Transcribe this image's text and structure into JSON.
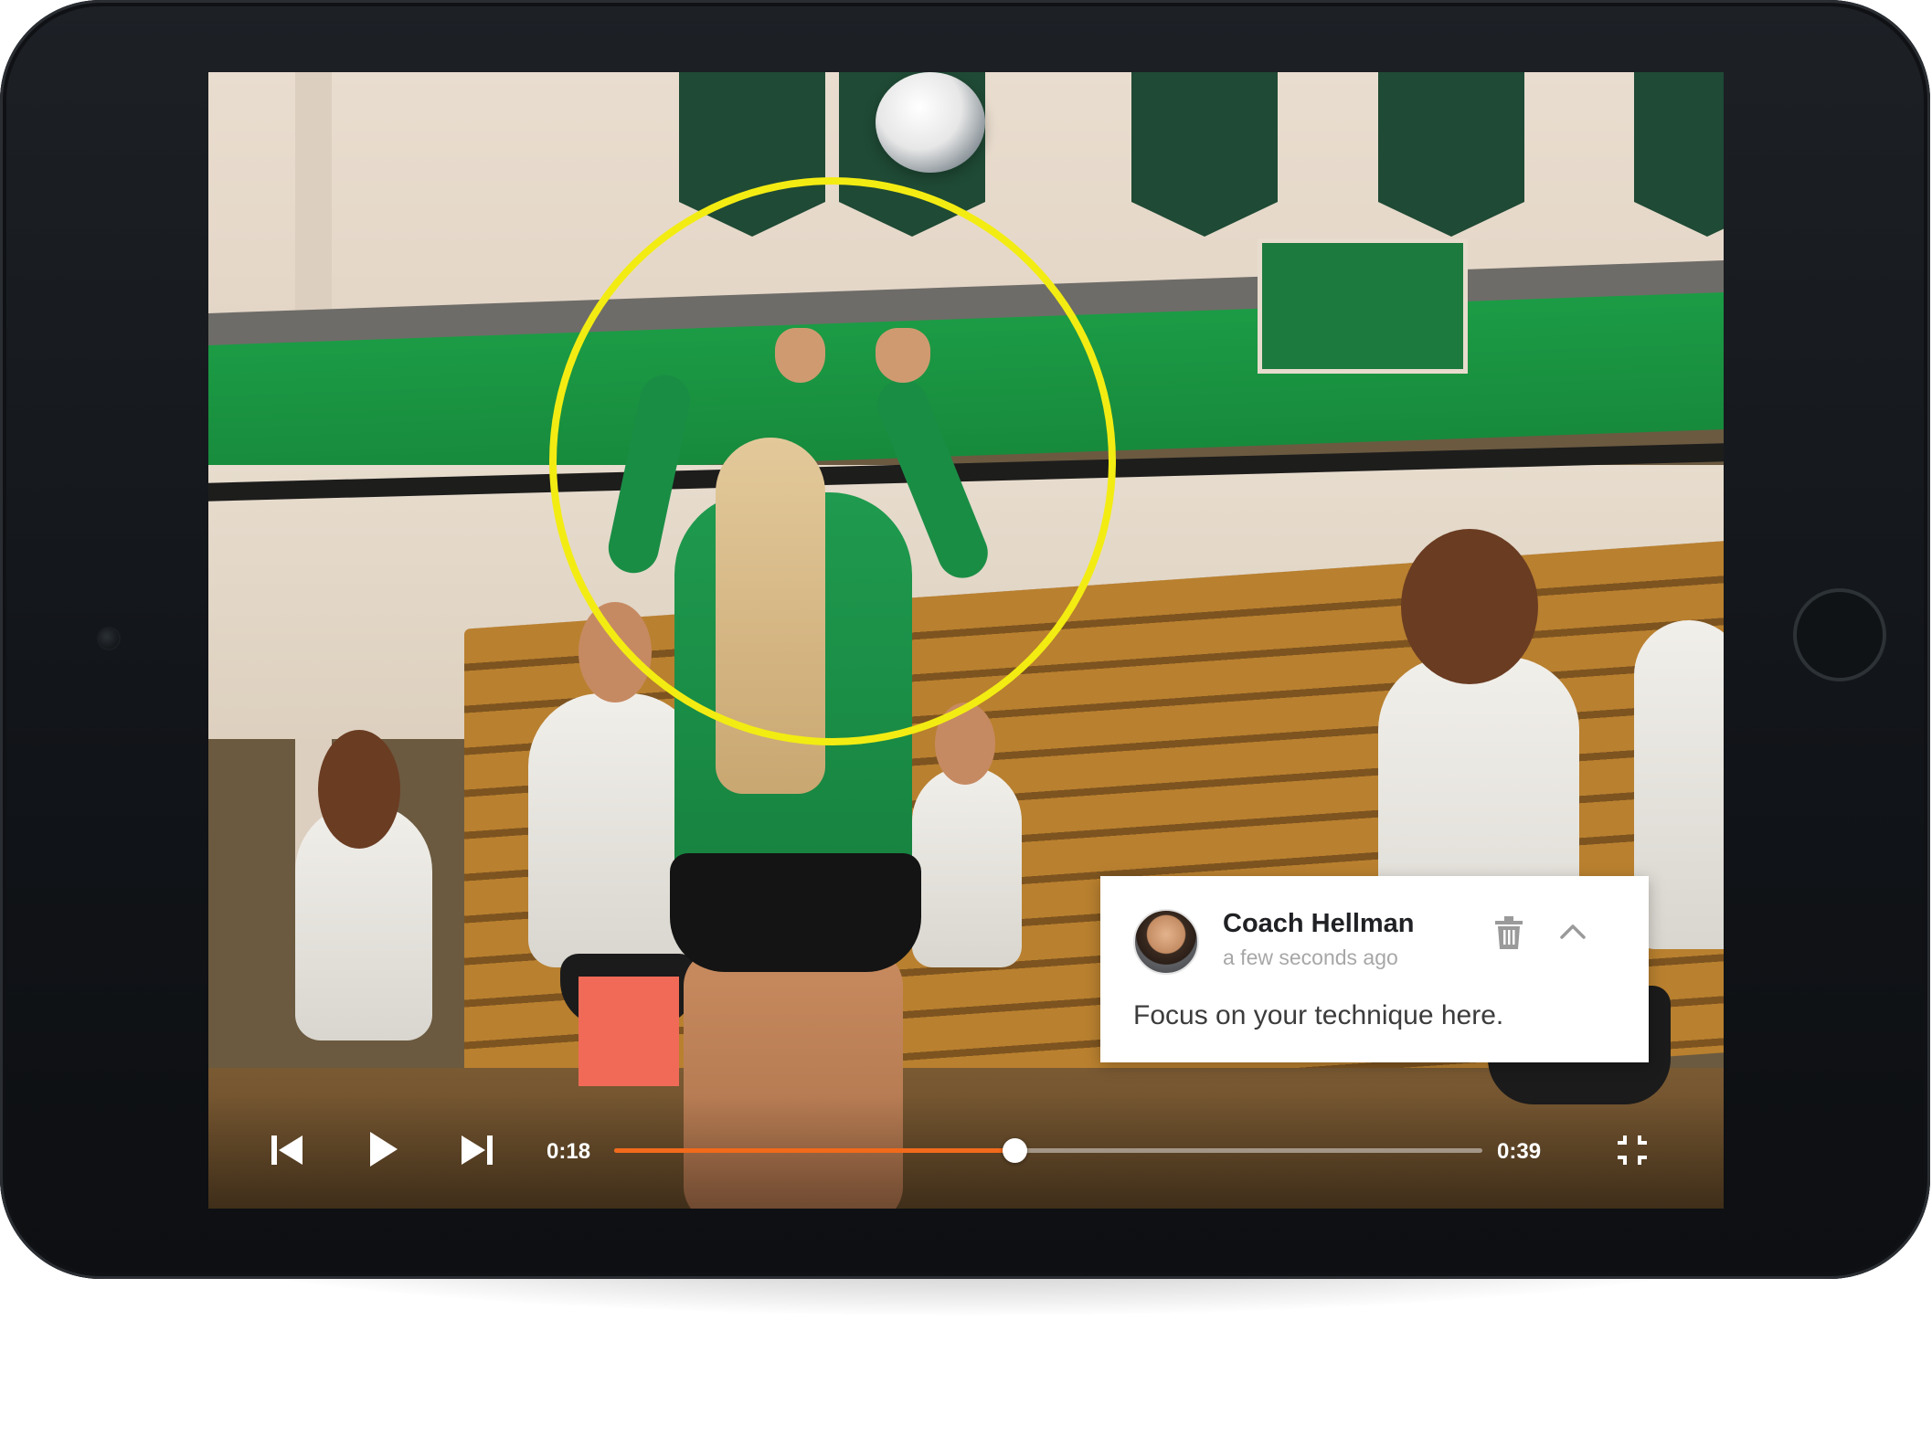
{
  "player": {
    "current_time": "0:18",
    "duration": "0:39",
    "progress_fraction": 0.4615,
    "accent_color": "#f26a1b"
  },
  "controls": {
    "skip_back_icon": "skip-previous-icon",
    "play_icon": "play-icon",
    "skip_forward_icon": "skip-next-icon",
    "exit_fullscreen_icon": "exit-fullscreen-icon"
  },
  "annotation": {
    "shape": "circle",
    "color": "#f3ec12"
  },
  "comment": {
    "author": "Coach Hellman",
    "time": "a few seconds ago",
    "text": "Focus on your technique here.",
    "delete_icon": "trash-icon",
    "collapse_icon": "chevron-up-icon"
  }
}
